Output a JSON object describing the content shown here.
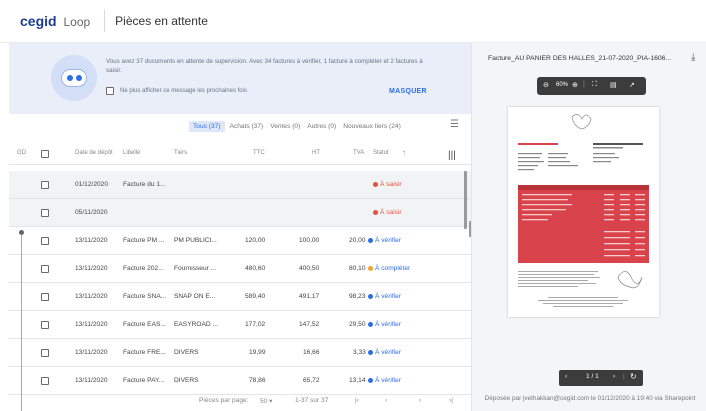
{
  "app": {
    "brand": "cegid",
    "product": "Loop",
    "page_title": "Pièces en attente"
  },
  "banner": {
    "message": "Vous avez 37 documents en attente de supervision. Avec 34 factures à vérifier, 1 facture à compléter et 2 factures à saisir.",
    "checkbox_label": "Ne plus afficher ce message les prochaines fois",
    "dismiss_label": "MASQUER"
  },
  "filters": [
    {
      "label": "Tous (37)",
      "active": true
    },
    {
      "label": "Achats (37)",
      "active": false
    },
    {
      "label": "Ventes (0)",
      "active": false
    },
    {
      "label": "Autres (0)",
      "active": false
    },
    {
      "label": "Nouveaux tiers (24)",
      "active": false
    }
  ],
  "table": {
    "headers": {
      "gd": "GD",
      "date": "Date de dépôt",
      "libelle": "Libellé",
      "tiers": "Tiers",
      "ttc": "TTC",
      "ht": "HT",
      "tva": "TVA",
      "statut": "Statut"
    },
    "rows": [
      {
        "date": "01/12/2020",
        "libelle": "Facture du 1...",
        "tiers": "",
        "ttc": "",
        "ht": "",
        "tva": "",
        "statut": "À saisir"
      },
      {
        "date": "05/11/2020",
        "libelle": "",
        "tiers": "",
        "ttc": "",
        "ht": "",
        "tva": "",
        "statut": "À saisir"
      },
      {
        "date": "13/11/2020",
        "libelle": "Facture PM ...",
        "tiers": "PM PUBLICI...",
        "ttc": "120,00",
        "ht": "100,00",
        "tva": "20,00",
        "statut": "À vérifier"
      },
      {
        "date": "13/11/2020",
        "libelle": "Facture 202...",
        "tiers": "Fournisseur ...",
        "ttc": "480,60",
        "ht": "400,50",
        "tva": "80,10",
        "statut": "À compléter"
      },
      {
        "date": "13/11/2020",
        "libelle": "Facture SNA...",
        "tiers": "SNAP ON E...",
        "ttc": "589,40",
        "ht": "491,17",
        "tva": "98,23",
        "statut": "À vérifier"
      },
      {
        "date": "13/11/2020",
        "libelle": "Facture EAS...",
        "tiers": "EASYROAD ...",
        "ttc": "177,02",
        "ht": "147,52",
        "tva": "29,50",
        "statut": "À vérifier"
      },
      {
        "date": "13/11/2020",
        "libelle": "Facture FRE...",
        "tiers": "DIVERS",
        "ttc": "19,99",
        "ht": "16,66",
        "tva": "3,33",
        "statut": "À vérifier"
      },
      {
        "date": "13/11/2020",
        "libelle": "Facture PAY...",
        "tiers": "DIVERS",
        "ttc": "78,86",
        "ht": "65,72",
        "tva": "13,14",
        "statut": "À vérifier"
      }
    ]
  },
  "pager": {
    "label": "Pièces par page:",
    "per_page": "50",
    "range": "1-37 sur 37"
  },
  "preview": {
    "file_name": "Facture_AU PANIER DES HALLES_21-07-2020_PIA-1606...",
    "zoom": "60%",
    "page_indicator": "1 / 1",
    "uploaded_info": "Déposée par jvethakkan@cegid.com le 01/12/2020 à 19:40 via Sharepoint"
  },
  "colors": {
    "accent": "#2d6ee8",
    "status_saisir": "#e2533f",
    "status_verifier": "#2d6ee8",
    "status_completer": "#f3a531",
    "doc_header": "#d9434c"
  }
}
